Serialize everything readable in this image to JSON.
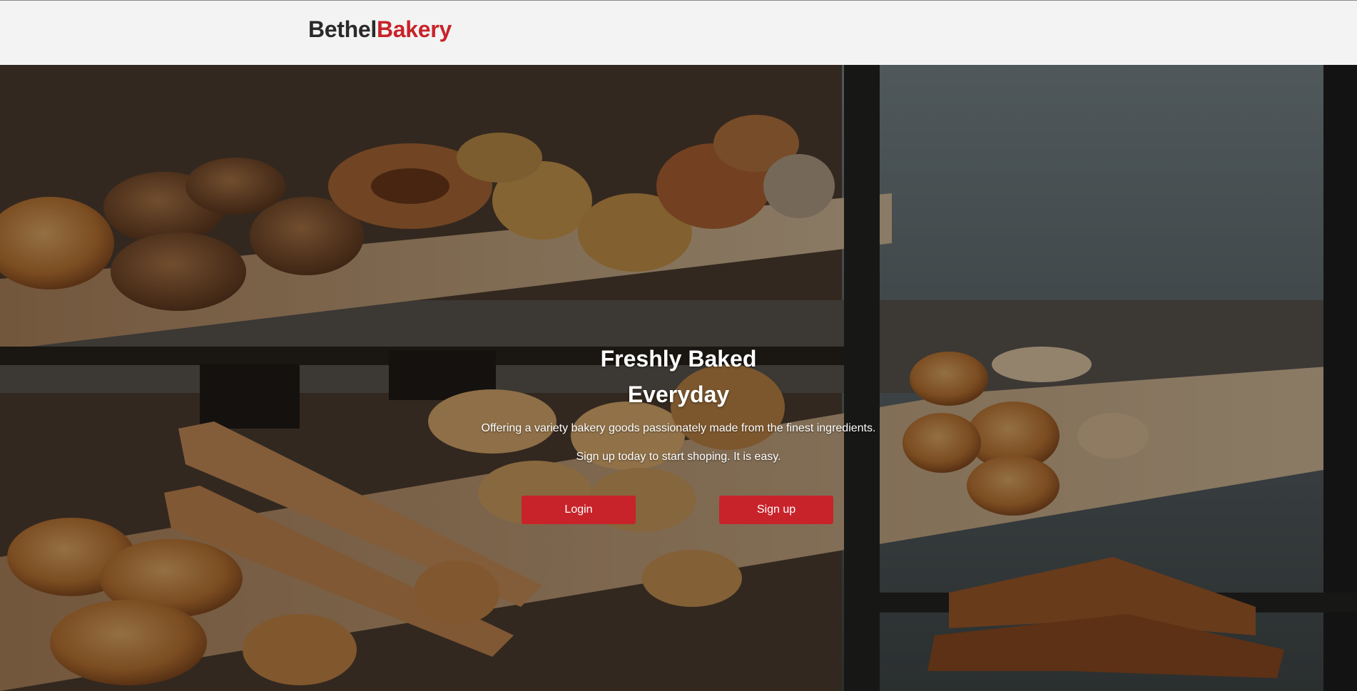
{
  "brand": {
    "name_part1": "Bethel",
    "name_part2": "Bakery",
    "color_primary": "#2a2a2a",
    "color_accent": "#c8232a"
  },
  "hero": {
    "headline_line1": "Freshly Baked",
    "headline_line2": "Everyday",
    "tagline": "Offering a variety bakery goods passionately made from the finest ingredients.",
    "cta_text": "Sign up today to start shoping. It is easy.",
    "background_image": "bakery-display-case-with-breads"
  },
  "actions": {
    "login_label": "Login",
    "signup_label": "Sign up",
    "button_color": "#c8232a"
  }
}
